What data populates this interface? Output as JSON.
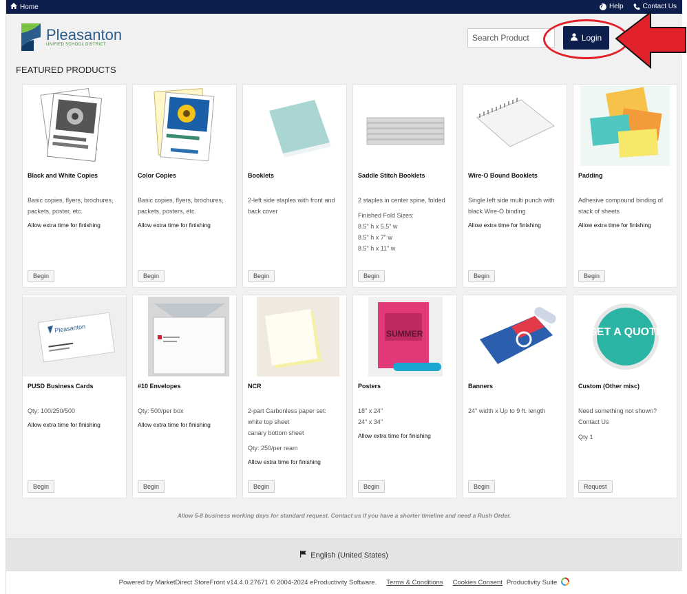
{
  "topbar": {
    "home": "Home",
    "help": "Help",
    "contact": "Contact Us"
  },
  "brand": {
    "name": "Pleasanton",
    "sub": "UNIFIED SCHOOL DISTRICT"
  },
  "search": {
    "placeholder": "Search Product"
  },
  "login": {
    "label": "Login"
  },
  "featured_title": "FEATURED PRODUCTS",
  "products": [
    {
      "title": "Black and White Copies",
      "lines": [
        "Basic copies, flyers, brochures, packets, poster, etc."
      ],
      "bold": "Allow extra time for finishing",
      "button": "Begin"
    },
    {
      "title": "Color Copies",
      "lines": [
        "Basic copies, flyers, brochures, packets, posters, etc."
      ],
      "bold": "Allow extra time for finishing",
      "button": "Begin"
    },
    {
      "title": "Booklets",
      "lines": [
        "2-left side staples with front and back cover"
      ],
      "bold": "",
      "button": "Begin"
    },
    {
      "title": "Saddle Stitch Booklets",
      "lines": [
        "2 staples in center spine, folded",
        "Finished Fold Sizes:",
        "8.5\" h x 5.5\" w",
        "8.5\" h x 7\" w",
        "8.5\" h x 11\" w"
      ],
      "bold": "",
      "button": "Begin"
    },
    {
      "title": "Wire-O Bound Booklets",
      "lines": [
        "Single left side multi punch with black Wire-O binding"
      ],
      "bold": "Allow extra time for finishing",
      "button": "Begin"
    },
    {
      "title": "Padding",
      "lines": [
        "Adhesive compound binding of stack of sheets"
      ],
      "bold": "Allow extra time for finishing",
      "button": "Begin"
    },
    {
      "title": "PUSD Business Cards",
      "lines": [
        "Qty: 100/250/500"
      ],
      "bold": "Allow extra time for finishing",
      "button": "Begin"
    },
    {
      "title": "#10 Envelopes",
      "lines": [
        "Qty: 500/per box"
      ],
      "bold": "Allow extra time for finishing",
      "button": "Begin"
    },
    {
      "title": "NCR",
      "lines": [
        "2-part Carbonless paper set:",
        "white top sheet",
        "canary bottom sheet",
        "Qty: 250/per ream"
      ],
      "bold": "Allow extra time for finishing",
      "button": "Begin"
    },
    {
      "title": "Posters",
      "lines": [
        "18\" x 24\"",
        "24\" x 34\""
      ],
      "bold": "Allow extra time for finishing",
      "button": "Begin"
    },
    {
      "title": "Banners",
      "lines": [
        "24\" width x Up to 9 ft. length"
      ],
      "bold": "",
      "button": "Begin"
    },
    {
      "title": "Custom (Other misc)",
      "lines": [
        "Need something not shown? Contact Us",
        "Qty 1"
      ],
      "bold": "",
      "button": "Request"
    }
  ],
  "thumb_text": {
    "card_brand": "Pleasanton",
    "poster": "SUMMER",
    "quote": "GET A QUOTE"
  },
  "note": "Allow 5-8 business working days for standard request. Contact us if you have a shorter timeline and need a Rush Order.",
  "language": "English (United States)",
  "footer": {
    "powered": "Powered by MarketDirect StoreFront  v14.4.0.27671  © 2004-2024 eProductivity Software.",
    "terms": "Terms & Conditions",
    "cookies": "Cookies Consent",
    "suite": "Productivity Suite"
  },
  "colors": {
    "navy": "#0d1e4d",
    "annotation_red": "#e1222a"
  }
}
